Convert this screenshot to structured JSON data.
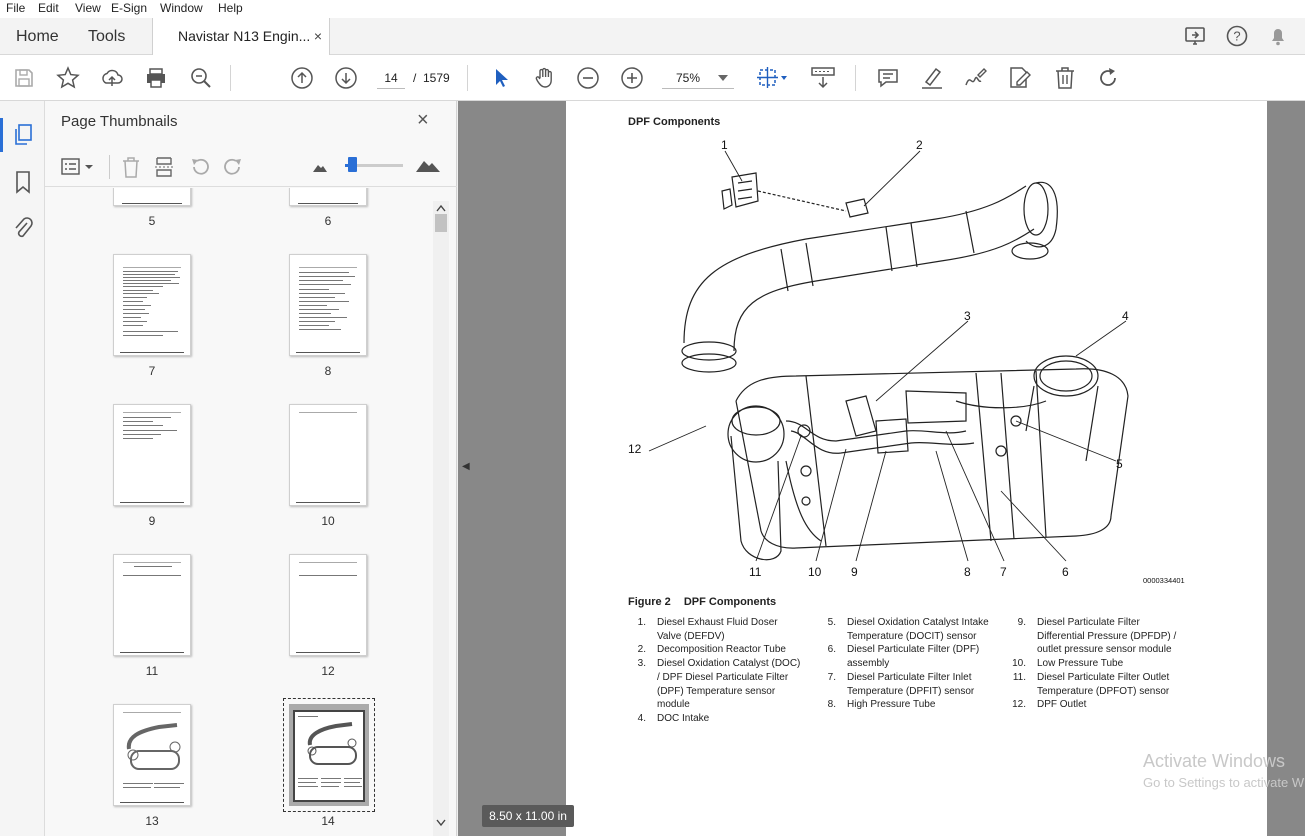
{
  "menu": [
    "File",
    "Edit",
    "View",
    "E-Sign",
    "Window",
    "Help"
  ],
  "tabs": {
    "home": "Home",
    "tools": "Tools",
    "document": "Navistar N13 Engin...",
    "close": "×"
  },
  "toolbar": {
    "current_page": "14",
    "page_separator": "/",
    "total_pages": "1579",
    "zoom": "75%"
  },
  "sidebar": {
    "title": "Page Thumbnails",
    "close": "×"
  },
  "thumbnails": [
    {
      "num": "5"
    },
    {
      "num": "6"
    },
    {
      "num": "7"
    },
    {
      "num": "8"
    },
    {
      "num": "9"
    },
    {
      "num": "10"
    },
    {
      "num": "11"
    },
    {
      "num": "12"
    },
    {
      "num": "13"
    },
    {
      "num": "14",
      "selected": true
    }
  ],
  "document": {
    "section_title": "DPF Components",
    "figure_id": "0000334401",
    "callouts": [
      "1",
      "2",
      "3",
      "4",
      "5",
      "6",
      "7",
      "8",
      "9",
      "10",
      "11",
      "12"
    ],
    "caption_label": "Figure 2",
    "caption_title": "DPF Components",
    "legend": [
      {
        "num": "1.",
        "lines": [
          "Diesel Exhaust Fluid Doser",
          "Valve (DEFDV)"
        ]
      },
      {
        "num": "2.",
        "lines": [
          "Decomposition Reactor Tube"
        ]
      },
      {
        "num": "3.",
        "lines": [
          "Diesel Oxidation Catalyst (DOC)",
          "/ DPF Diesel Particulate Filter",
          "(DPF) Temperature sensor",
          "module"
        ]
      },
      {
        "num": "4.",
        "lines": [
          "DOC Intake"
        ]
      },
      {
        "num": "5.",
        "lines": [
          "Diesel Oxidation Catalyst Intake",
          "Temperature (DOCIT) sensor"
        ]
      },
      {
        "num": "6.",
        "lines": [
          "Diesel Particulate Filter (DPF)",
          "assembly"
        ]
      },
      {
        "num": "7.",
        "lines": [
          "Diesel Particulate Filter Inlet",
          "Temperature (DPFIT) sensor"
        ]
      },
      {
        "num": "8.",
        "lines": [
          "High Pressure Tube"
        ]
      },
      {
        "num": "9.",
        "lines": [
          "Diesel Particulate Filter",
          "Differential Pressure (DPFDP) /",
          "outlet pressure sensor module"
        ]
      },
      {
        "num": "10.",
        "lines": [
          "Low Pressure Tube"
        ]
      },
      {
        "num": "11.",
        "lines": [
          "Diesel Particulate Filter Outlet",
          "Temperature (DPFOT) sensor"
        ]
      },
      {
        "num": "12.",
        "lines": [
          "DPF Outlet"
        ]
      }
    ]
  },
  "page_size_label": "8.50 x 11.00 in",
  "watermark": {
    "line1": "Activate Windows",
    "line2": "Go to Settings to activate Windows."
  },
  "icons": [
    "save-icon",
    "star-icon",
    "upload-icon",
    "print-icon",
    "zoom-search-icon",
    "arrow-up-icon",
    "arrow-down-icon",
    "select-cursor-icon",
    "hand-icon",
    "zoom-out-icon",
    "zoom-in-icon",
    "fit-page-icon",
    "scroll-mode-icon",
    "comment-icon",
    "highlight-icon",
    "sign-icon",
    "edit-icon",
    "delete-icon",
    "redo-icon",
    "share-screen-icon",
    "help-icon",
    "bell-icon"
  ],
  "colors": {
    "accent": "#2a6fd6",
    "page_bg": "#ffffff",
    "viewer_bg": "#888888"
  }
}
